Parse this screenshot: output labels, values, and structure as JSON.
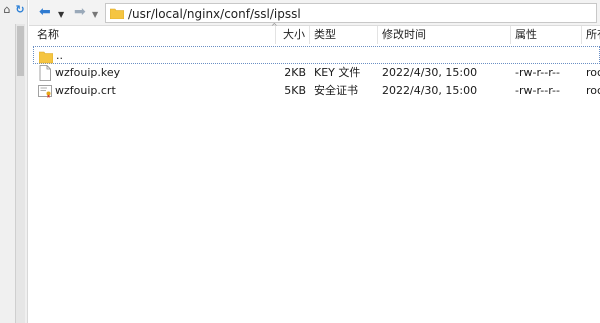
{
  "toolbar": {
    "path": "/usr/local/nginx/conf/ssl/ipssl"
  },
  "columns": {
    "name": "名称",
    "size": "大小",
    "type": "类型",
    "modified": "修改时间",
    "attributes": "属性",
    "owner": "所有"
  },
  "parent_row": {
    "name": ".."
  },
  "files": [
    {
      "name": "wzfouip.key",
      "size": "2KB",
      "type": "KEY 文件",
      "modified": "2022/4/30, 15:00",
      "attributes": "-rw-r--r--",
      "owner": "roc",
      "icon": "text-file-icon"
    },
    {
      "name": "wzfouip.crt",
      "size": "5KB",
      "type": "安全证书",
      "modified": "2022/4/30, 15:00",
      "attributes": "-rw-r--r--",
      "owner": "roc",
      "icon": "certificate-file-icon"
    }
  ],
  "colors": {
    "folder": "#f5c542",
    "nav_arrow": "#2f7ad0",
    "selection_border": "#6a8fc4"
  }
}
